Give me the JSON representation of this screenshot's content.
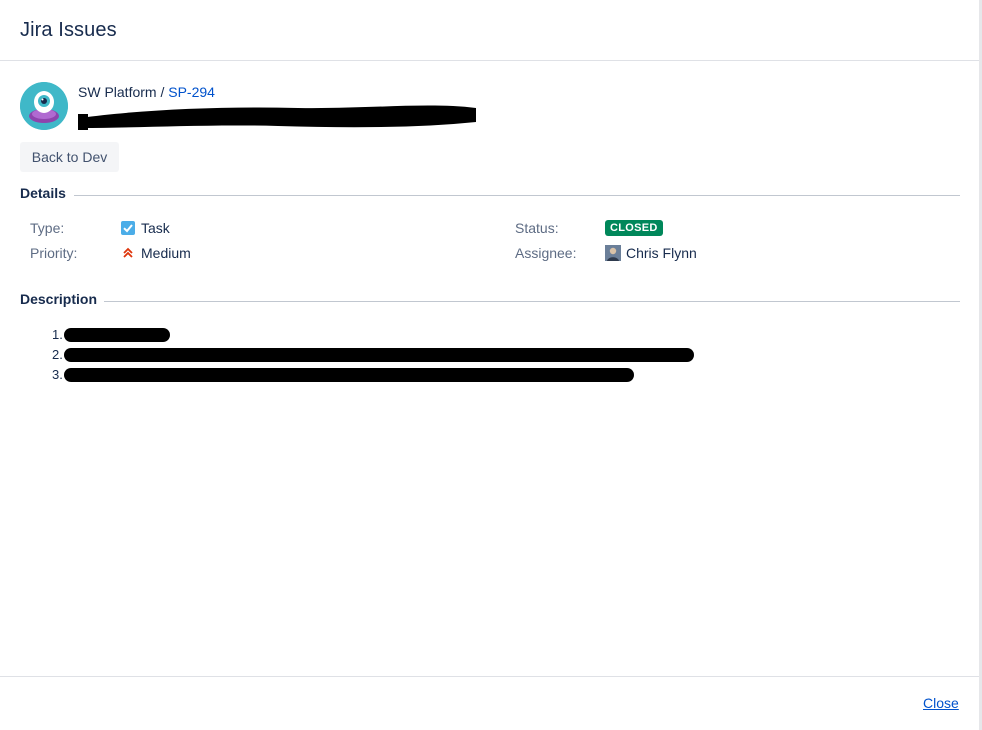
{
  "dialog": {
    "title": "Jira Issues"
  },
  "issue": {
    "project": "SW Platform",
    "separator": " / ",
    "key": "SP-294",
    "summary_redacted": true
  },
  "actions": {
    "back_label": "Back to Dev"
  },
  "details": {
    "heading": "Details",
    "type_label": "Type:",
    "type_value": "Task",
    "priority_label": "Priority:",
    "priority_value": "Medium",
    "status_label": "Status:",
    "status_value": "CLOSED",
    "assignee_label": "Assignee:",
    "assignee_value": "Chris Flynn"
  },
  "description": {
    "heading": "Description",
    "items": [
      {
        "number": "1."
      },
      {
        "number": "2."
      },
      {
        "number": "3."
      }
    ]
  },
  "footer": {
    "close_label": "Close"
  },
  "colors": {
    "accent": "#0052cc",
    "status_closed": "#00875a",
    "priority_medium": "#de350b",
    "task_icon": "#4bade8"
  },
  "icons": {
    "project_avatar": "alien-avatar-icon",
    "type": "task-checkbox-icon",
    "priority": "priority-medium-icon",
    "assignee": "user-avatar-icon"
  }
}
